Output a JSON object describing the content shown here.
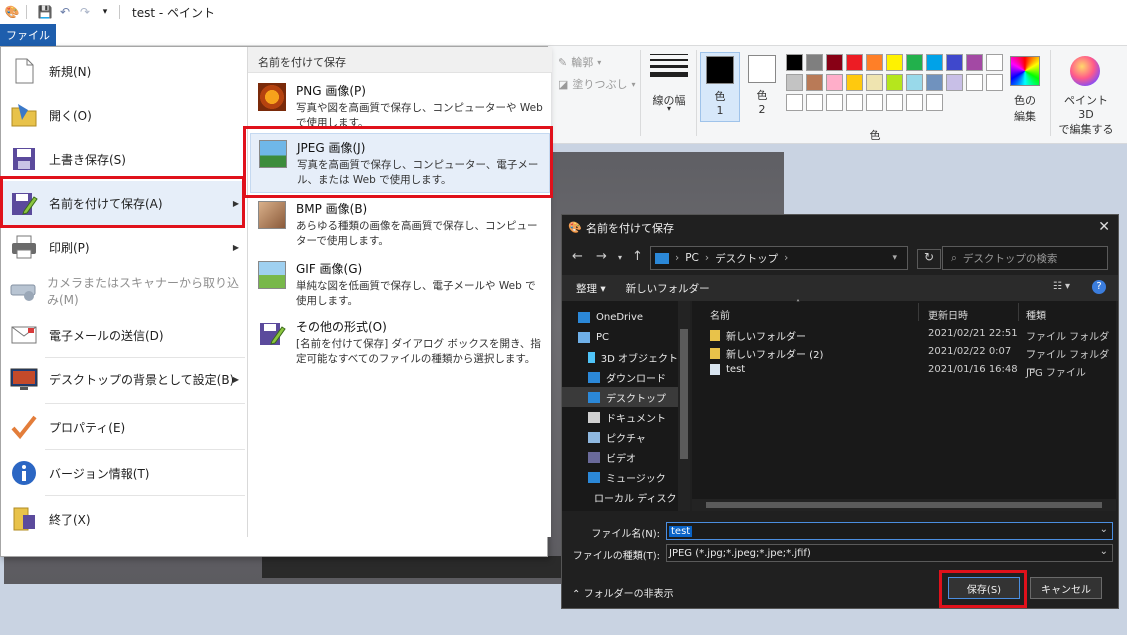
{
  "window": {
    "title": "test - ペイント",
    "file_tab": "ファイル"
  },
  "ribbon": {
    "outline": "輪郭",
    "fill": "塗りつぶし",
    "line_width": "線の幅",
    "color1": "色\n1",
    "color1_a": "色",
    "color1_b": "1",
    "color2_a": "色",
    "color2_b": "2",
    "edit_colors_a": "色の",
    "edit_colors_b": "編集",
    "paint3d_a": "ペイント 3D",
    "paint3d_b": "で編集する",
    "colors_group": "色",
    "palette": [
      "#000000",
      "#7f7f7f",
      "#880015",
      "#ed1c24",
      "#ff7f27",
      "#fff200",
      "#22b14c",
      "#00a2e8",
      "#3f48cc",
      "#a349a4",
      "#ffffff",
      "#c3c3c3",
      "#b97a57",
      "#ffaec9",
      "#ffc90e",
      "#efe4b0",
      "#b5e61d",
      "#99d9ea",
      "#7092be",
      "#c8bfe7",
      "#ffffff",
      "#ffffff",
      "#ffffff",
      "#ffffff",
      "#ffffff",
      "#ffffff",
      "#ffffff",
      "#ffffff",
      "#ffffff",
      "#ffffff"
    ]
  },
  "file_menu": {
    "items": [
      {
        "label": "新規(N)",
        "icon": "new-file-icon"
      },
      {
        "label": "開く(O)",
        "icon": "open-folder-icon"
      },
      {
        "label": "上書き保存(S)",
        "icon": "save-icon"
      },
      {
        "label": "名前を付けて保存(A)",
        "icon": "save-as-icon"
      },
      {
        "label": "印刷(P)",
        "icon": "printer-icon"
      },
      {
        "label": "カメラまたはスキャナーから取り込み(M)",
        "icon": "scanner-icon"
      },
      {
        "label": "電子メールの送信(D)",
        "icon": "email-icon"
      },
      {
        "label": "デスクトップの背景として設定(B)",
        "icon": "desktop-icon"
      },
      {
        "label": "プロパティ(E)",
        "icon": "checkmark-icon"
      },
      {
        "label": "バージョン情報(T)",
        "icon": "info-icon"
      },
      {
        "label": "終了(X)",
        "icon": "exit-icon"
      }
    ],
    "submenu_header": "名前を付けて保存",
    "submenu": [
      {
        "title": "PNG 画像(P)",
        "desc": "写真や図を高画質で保存し、コンピューターや Web で使用します。"
      },
      {
        "title": "JPEG 画像(J)",
        "desc": "写真を高画質で保存し、コンピューター、電子メール、または Web で使用します。"
      },
      {
        "title": "BMP 画像(B)",
        "desc": "あらゆる種類の画像を高画質で保存し、コンピューターで使用します。"
      },
      {
        "title": "GIF 画像(G)",
        "desc": "単純な図を低画質で保存し、電子メールや Web で使用します。"
      },
      {
        "title": "その他の形式(O)",
        "desc": "[名前を付けて保存] ダイアログ ボックスを開き、指定可能なすべてのファイルの種類から選択します。"
      }
    ]
  },
  "dialog": {
    "title": "名前を付けて保存",
    "close": "✕",
    "address": [
      "PC",
      "デスクトップ"
    ],
    "search_placeholder": "デスクトップの検索",
    "toolbar": {
      "organize": "整理 ▾",
      "new_folder": "新しいフォルダー",
      "help": "?"
    },
    "tree": [
      {
        "label": "OneDrive",
        "color": "#2b88d8"
      },
      {
        "label": "PC",
        "color": "#6fb0e8"
      },
      {
        "label": "3D オブジェクト",
        "color": "#4fc3f7"
      },
      {
        "label": "ダウンロード",
        "color": "#2b88d8"
      },
      {
        "label": "デスクトップ",
        "color": "#2b88d8"
      },
      {
        "label": "ドキュメント",
        "color": "#d0d0d0"
      },
      {
        "label": "ピクチャ",
        "color": "#8fb8e0"
      },
      {
        "label": "ビデオ",
        "color": "#6a6a9a"
      },
      {
        "label": "ミュージック",
        "color": "#2b88d8"
      },
      {
        "label": "ローカル ディスク (C",
        "color": "#9a9a9a"
      }
    ],
    "columns": {
      "name": "名前",
      "date": "更新日時",
      "type": "種類"
    },
    "files": [
      {
        "name": "新しいフォルダー",
        "date": "2021/02/21 22:51",
        "type": "ファイル フォルダー",
        "kind": "folder"
      },
      {
        "name": "新しいフォルダー (2)",
        "date": "2021/02/22 0:07",
        "type": "ファイル フォルダー",
        "kind": "folder"
      },
      {
        "name": "test",
        "date": "2021/01/16 16:48",
        "type": "JPG ファイル",
        "kind": "file"
      }
    ],
    "filename_label": "ファイル名(N):",
    "filename_value": "test",
    "filetype_label": "ファイルの種類(T):",
    "filetype_value": "JPEG (*.jpg;*.jpeg;*.jpe;*.jfif)",
    "hide_folders": "フォルダーの非表示",
    "save": "保存(S)",
    "cancel": "キャンセル"
  }
}
